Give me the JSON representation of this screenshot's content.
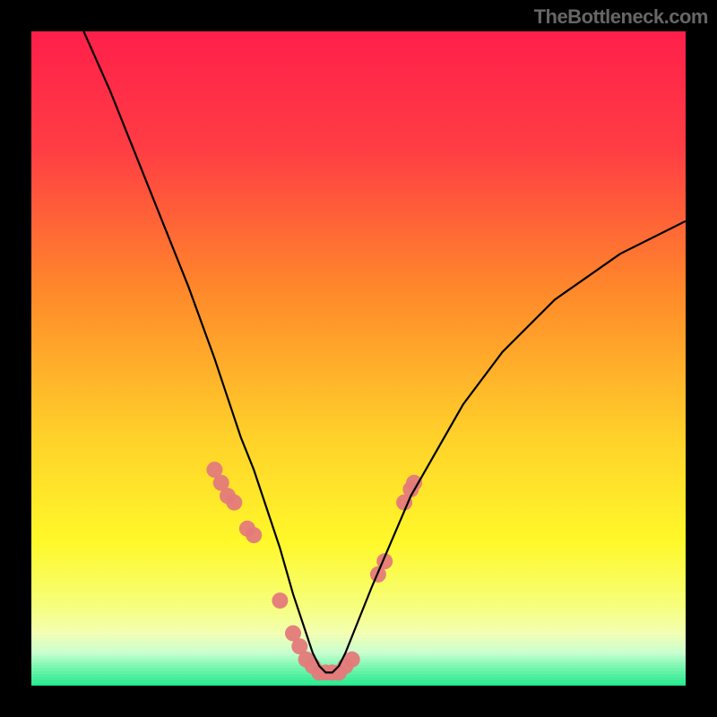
{
  "watermark": "TheBottleneck.com",
  "chart_data": {
    "type": "line",
    "title": "",
    "xlabel": "",
    "ylabel": "",
    "xlim": [
      0,
      100
    ],
    "ylim": [
      0,
      100
    ],
    "curve": {
      "name": "bottleneck-curve",
      "x": [
        8,
        12,
        16,
        20,
        24,
        28,
        30,
        32,
        34,
        36,
        38,
        40,
        41,
        42,
        43,
        44,
        45,
        46,
        47,
        48,
        50,
        52,
        55,
        58,
        62,
        66,
        72,
        80,
        90,
        100
      ],
      "y": [
        100,
        91,
        81,
        71,
        61,
        50,
        44,
        38,
        33,
        27,
        21,
        14,
        11,
        8,
        5,
        3,
        2,
        2,
        3,
        5,
        10,
        15,
        22,
        29,
        36,
        43,
        51,
        59,
        66,
        71
      ]
    },
    "markers": {
      "name": "highlight-points",
      "color": "#e47a7a",
      "radius": 9,
      "x": [
        28,
        29,
        30,
        31,
        33,
        34,
        38,
        40,
        41,
        42,
        43,
        44,
        45,
        46,
        47,
        48,
        49,
        53,
        54,
        57,
        58,
        58.5
      ],
      "y": [
        33,
        31,
        29,
        28,
        24,
        23,
        13,
        8,
        6,
        4,
        3,
        2,
        2,
        2,
        2,
        3,
        4,
        17,
        19,
        28,
        30,
        31
      ]
    },
    "background_bands": [
      {
        "y0": 100,
        "y1": 60,
        "color_top": "#ff1f4a",
        "color_bot": "#ff8a2a"
      },
      {
        "y0": 60,
        "y1": 30,
        "color_top": "#ff8a2a",
        "color_bot": "#ffe82a"
      },
      {
        "y0": 30,
        "y1": 10,
        "color_top": "#ffe82a",
        "color_bot": "#f8ff6a"
      },
      {
        "y0": 10,
        "y1": 4,
        "color_top": "#f8ff6a",
        "color_bot": "#d2ffb0"
      },
      {
        "y0": 4,
        "y1": 0,
        "color_top": "#d2ffb0",
        "color_bot": "#1fe88a"
      }
    ]
  }
}
